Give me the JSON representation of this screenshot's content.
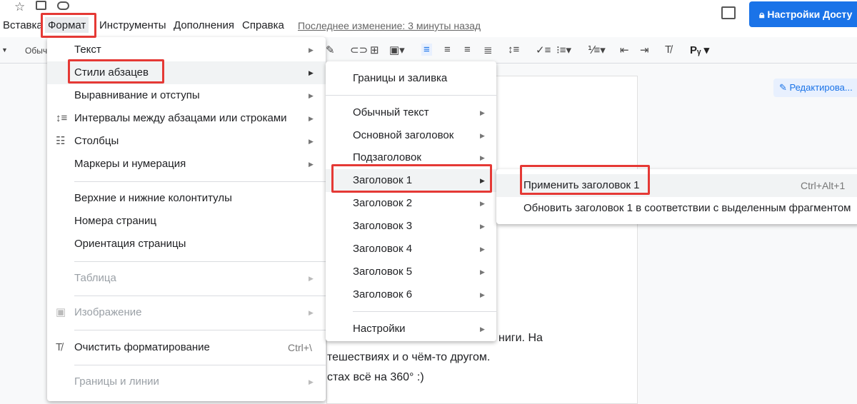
{
  "topbar": {
    "star_icon": "star-icon",
    "move_icon": "folder-move-icon",
    "cloud_icon": "cloud-status-icon",
    "comments_icon": "comments-icon",
    "share_label": "Настройки Досту"
  },
  "menubar": {
    "items": [
      "Вставка",
      "Формат",
      "Инструменты",
      "Дополнения",
      "Справка"
    ],
    "last_edit": "Последнее изменение: 3 минуты назад"
  },
  "toolbar": {
    "style_label": "Обыч",
    "mode_label": "Редактирова..."
  },
  "format_menu": {
    "items": [
      {
        "label": "Текст"
      },
      {
        "label": "Стили абзацев"
      },
      {
        "label": "Выравнивание и отступы"
      },
      {
        "label": "Интервалы между абзацами или строками"
      },
      {
        "label": "Столбцы"
      },
      {
        "label": "Маркеры и нумерация"
      },
      {
        "label": "Верхние и нижние колонтитулы"
      },
      {
        "label": "Номера страниц"
      },
      {
        "label": "Ориентация страницы"
      },
      {
        "label": "Таблица"
      },
      {
        "label": "Изображение"
      },
      {
        "label": "Очистить форматирование",
        "shortcut": "Ctrl+\\"
      },
      {
        "label": "Границы и линии"
      }
    ]
  },
  "styles_menu": {
    "items": [
      "Границы и заливка",
      "Обычный текст",
      "Основной заголовок",
      "Подзаголовок",
      "Заголовок 1",
      "Заголовок 2",
      "Заголовок 3",
      "Заголовок 4",
      "Заголовок 5",
      "Заголовок 6",
      "Настройки"
    ]
  },
  "heading_menu": {
    "items": [
      {
        "label": "Применить заголовок 1",
        "shortcut": "Ctrl+Alt+1"
      },
      {
        "label": "Обновить заголовок 1 в соответствии с выделенным фрагментом"
      }
    ]
  },
  "document": {
    "lines": [
      "ниги. На",
      "тешествиях и о чём-то другом.",
      "стах всё на 360° :)"
    ]
  }
}
